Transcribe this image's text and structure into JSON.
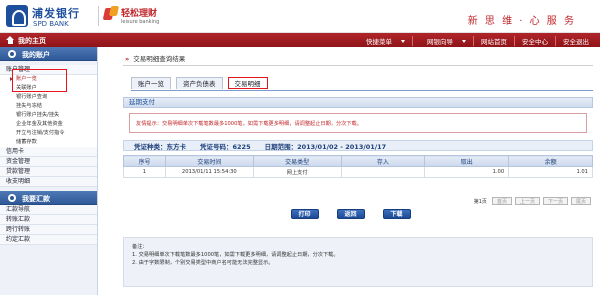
{
  "header": {
    "bank_name": "浦发银行",
    "bank_en": "SPD BANK",
    "product_name": "轻松理财",
    "product_en": "leisure banking",
    "slogan": "新 思 维 · 心 服 务"
  },
  "topnav": {
    "home_label": "我的主页",
    "menu": [
      "快捷菜单",
      "网银向导",
      "网站首页",
      "安全中心",
      "安全退出"
    ]
  },
  "sidebar": {
    "section1_title": "我的账户",
    "account_mgmt": "账户管理",
    "account_overview": "账户一览",
    "sub_items": [
      "关联账户",
      "银行账户查询",
      "挂失与冻结",
      "银行账户挂失/挂失",
      "企业年金及其他资金",
      "开立与注销/支付指令",
      "储蓄存款"
    ],
    "other_items": [
      "信用卡",
      "资金管理",
      "贷款管理",
      "收支明细"
    ],
    "section2_title": "我要汇款",
    "remit_items": [
      "汇款导航",
      "转账汇款",
      "跨行转账",
      "约定汇款"
    ]
  },
  "breadcrumb": "交易明细查询结果",
  "tabs": [
    "账户一览",
    "资产负债表",
    "交易明细"
  ],
  "section_title": "延期支付",
  "notice": "友情提示：交易明细单次下载笔数最多1000笔，如需下载更多明细，请调整起止日期，分次下载。",
  "summary": {
    "card_type": "凭证种类：东方卡",
    "card_no": "凭证号码：6225",
    "date_range": "日期范围：2013/01/02 - 2013/01/17"
  },
  "table": {
    "headers": [
      "序号",
      "交易时间",
      "交易类型",
      "存入",
      "取出",
      "余额"
    ],
    "rows": [
      [
        "1",
        "2013/01/11 15:54:30",
        "网上支付",
        "",
        "1.00",
        "1.01"
      ]
    ]
  },
  "pager": {
    "info": "第1页",
    "buttons": [
      "首页",
      "上一页",
      "下一页",
      "尾页"
    ]
  },
  "actions": [
    "打印",
    "返回",
    "下载"
  ],
  "notes": {
    "title": "备注：",
    "items": [
      "1. 交易明细单次下载笔数最多1000笔，如需下载更多明细，请调整起止日期，分次下载。",
      "2. 由于字数限制，个别交易类型中商户名可能无法完整显示。"
    ]
  },
  "colors": {
    "brand_red": "#b0252a",
    "brand_blue": "#1e4f9c",
    "highlight": "#e8141b"
  }
}
